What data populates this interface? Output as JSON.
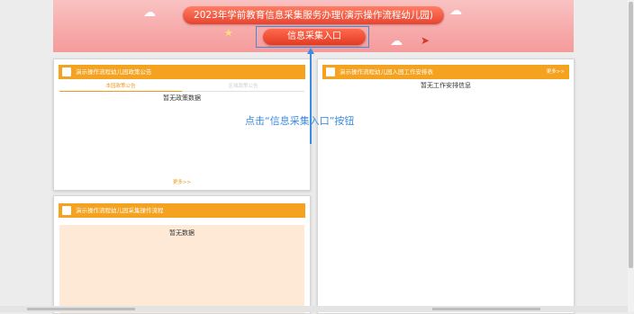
{
  "banner": {
    "title": "2023年学前教育信息采集服务办理(演示操作流程幼儿园)",
    "entry_button": "信息采集入口"
  },
  "policy_panel": {
    "title": "演示操作流程幼儿园政策公告",
    "tabs": [
      "本园政策公告",
      "区域政策公告"
    ],
    "empty_text": "暂无政策数据",
    "more": "更多>>"
  },
  "work_panel": {
    "title": "演示操作流程幼儿园入园工作安排表",
    "more": "更多>>",
    "empty_text": "暂无工作安排信息"
  },
  "flow_panel": {
    "title": "演示操作流程幼儿园采集操作流程",
    "empty_text": "暂无数据"
  },
  "annotation": {
    "text": "点击“信息采集入口”按钮"
  },
  "colors": {
    "accent_orange": "#f4a21f",
    "annotation_blue": "#3d8ce0",
    "button_red": "#e23b24"
  }
}
